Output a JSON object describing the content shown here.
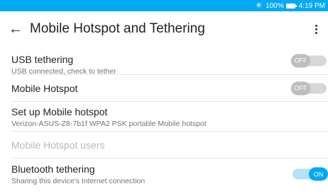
{
  "status_bar": {
    "battery": "100%",
    "time": "4:19 PM"
  },
  "app_bar": {
    "title": "Mobile Hotspot and Tethering"
  },
  "settings": {
    "usb": {
      "title": "USB tethering",
      "subtitle": "USB connected, check to tether",
      "toggle": "OFF"
    },
    "hotspot": {
      "title": "Mobile Hotspot",
      "toggle": "OFF"
    },
    "setup": {
      "title": "Set up Mobile hotspot",
      "subtitle": "Verizon-ASUS-Z8-7b1f WPA2 PSK portable Mobile hotspot"
    },
    "users": {
      "title": "Mobile Hotspot users"
    },
    "bluetooth": {
      "title": "Bluetooth tethering",
      "subtitle": "Sharing this device's Internet connection",
      "toggle": "ON"
    }
  },
  "colors": {
    "accent": "#03a9f4",
    "status_bar": "#03a9f4"
  },
  "icons": {
    "status": [
      "bluetooth-icon",
      "battery-icon"
    ],
    "app_bar": [
      "back-arrow-icon",
      "overflow-menu-icon"
    ]
  }
}
